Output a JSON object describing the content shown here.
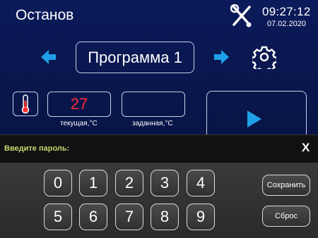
{
  "header": {
    "status": "Останов",
    "time": "09:27:12",
    "date": "07.02.2020"
  },
  "program": {
    "name": "Программа 1"
  },
  "temperature": {
    "current_value": "27",
    "current_label": "текущая,°С",
    "set_value": "",
    "set_label": "заданная,°С"
  },
  "password_dialog": {
    "prompt": "Введите пароль:",
    "close_label": "X",
    "keys": [
      "0",
      "1",
      "2",
      "3",
      "4",
      "5",
      "6",
      "7",
      "8",
      "9"
    ],
    "save_label": "Сохранить",
    "reset_label": "Сброс"
  },
  "colors": {
    "accent": "#1ea0e8",
    "value_text": "#ff2d2d",
    "prompt_text": "#c8d56a"
  }
}
